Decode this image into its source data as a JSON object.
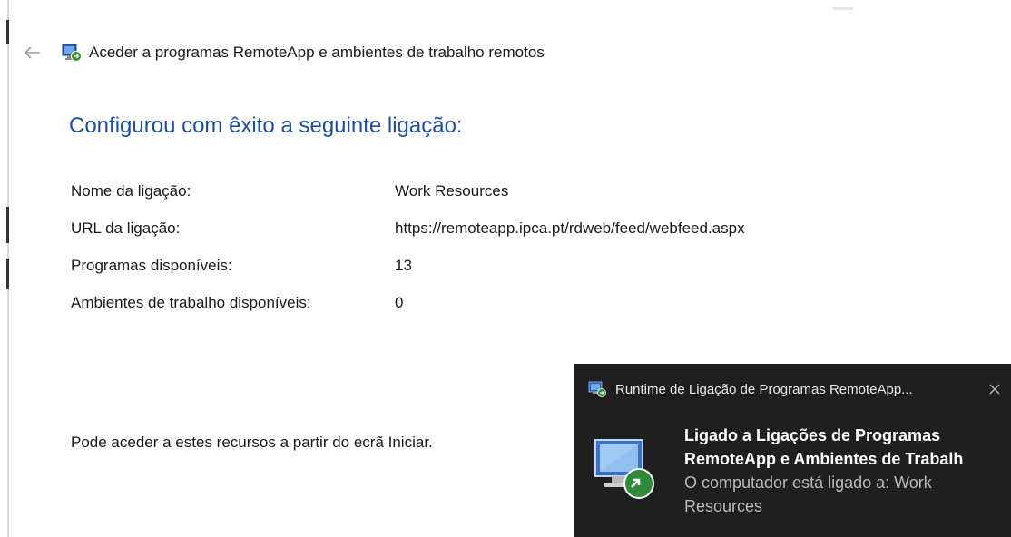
{
  "window": {
    "title": "Aceder a programas RemoteApp e ambientes de trabalho remotos",
    "back_icon": "back-arrow-icon",
    "app_icon": "remoteapp-connection-icon"
  },
  "main": {
    "heading": "Configurou com êxito a seguinte ligação:",
    "details": [
      {
        "label": "Nome da ligação:",
        "value": "Work Resources"
      },
      {
        "label": "URL da ligação:",
        "value": "https://remoteapp.ipca.pt/rdweb/feed/webfeed.aspx"
      },
      {
        "label": "Programas disponíveis:",
        "value": "13"
      },
      {
        "label": "Ambientes de trabalho disponíveis:",
        "value": "0"
      }
    ],
    "footer_note": "Pode aceder a estes recursos a partir do ecrã Iniciar."
  },
  "toast": {
    "app_name": "Runtime de Ligação de Programas RemoteApp...",
    "close_icon": "close-icon",
    "title_line1": "Ligado a Ligações de Programas",
    "title_line2": "RemoteApp e Ambientes de Trabalh",
    "text": "O computador está ligado a: Work Resources"
  },
  "colors": {
    "heading": "#1f4e9a",
    "toast_background": "#1f1f1f",
    "toast_secondary_text": "#b9b9b9"
  }
}
